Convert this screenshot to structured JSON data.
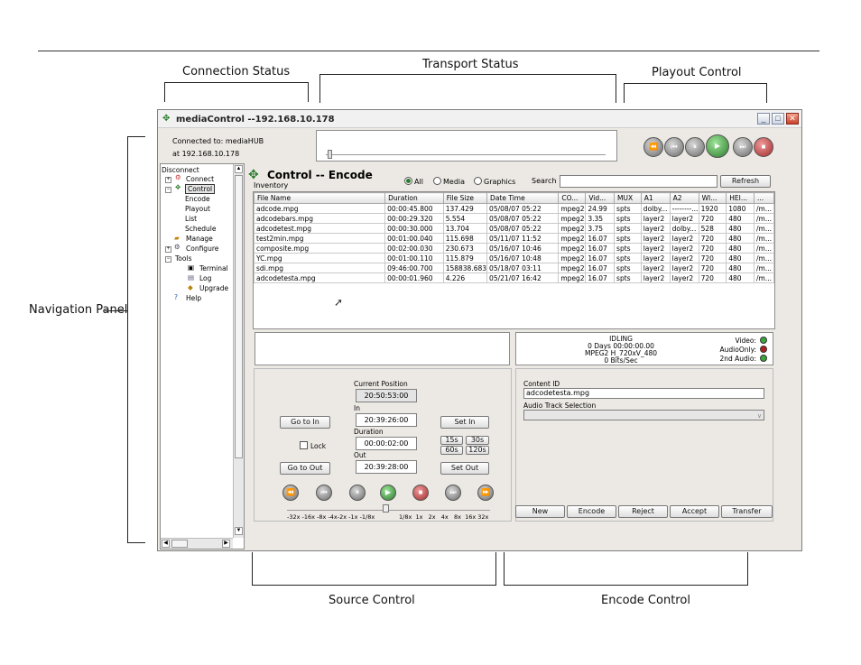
{
  "callouts": {
    "connection_status": "Connection Status",
    "transport_status": "Transport Status",
    "playout_control": "Playout Control",
    "navigation_panel": "Navigation Panel",
    "source_control": "Source Control",
    "encode_control": "Encode Control"
  },
  "window": {
    "title": "mediaControl --192.168.10.178",
    "min": "_",
    "max": "□",
    "close": "✕"
  },
  "connection": {
    "line1": "Connected to: mediaHUB",
    "line2": "at 192.168.10.178"
  },
  "nav": {
    "disconnect": "Disconnect",
    "connect": "Connect",
    "control": "Control",
    "encode": "Encode",
    "playout": "Playout",
    "list": "List",
    "schedule": "Schedule",
    "manage": "Manage",
    "configure": "Configure",
    "tools": "Tools",
    "terminal": "Terminal",
    "log": "Log",
    "upgrade": "Upgrade",
    "help": "Help"
  },
  "inventory": {
    "title": "Control -- Encode",
    "subtitle": "Inventory",
    "radio_all": "All",
    "radio_media": "Media",
    "radio_graphics": "Graphics",
    "search_label": "Search",
    "search_value": "",
    "refresh": "Refresh",
    "columns": [
      "File Name",
      "Duration",
      "File Size",
      "Date Time",
      "CO...",
      "Vid...",
      "MUX",
      "A1",
      "A2",
      "WI...",
      "HEI...",
      "..."
    ],
    "rows": [
      [
        "adcode.mpg",
        "00:00:45.800",
        "137.429",
        "05/08/07 05:22",
        "mpeg2",
        "24.99",
        "spts",
        "dolby...",
        "--------...",
        "1920",
        "1080",
        "/m..."
      ],
      [
        "adcodebars.mpg",
        "00:00:29.320",
        "5.554",
        "05/08/07 05:22",
        "mpeg2",
        "3.35",
        "spts",
        "layer2",
        "layer2",
        "720",
        "480",
        "/m..."
      ],
      [
        "adcodetest.mpg",
        "00:00:30.000",
        "13.704",
        "05/08/07 05:22",
        "mpeg2",
        "3.75",
        "spts",
        "layer2",
        "dolby...",
        "528",
        "480",
        "/m..."
      ],
      [
        "test2min.mpg",
        "00:01:00.040",
        "115.698",
        "05/11/07 11:52",
        "mpeg2",
        "16.07",
        "spts",
        "layer2",
        "layer2",
        "720",
        "480",
        "/m..."
      ],
      [
        "composite.mpg",
        "00:02:00.030",
        "230.673",
        "05/16/07 10:46",
        "mpeg2",
        "16.07",
        "spts",
        "layer2",
        "layer2",
        "720",
        "480",
        "/m..."
      ],
      [
        "YC.mpg",
        "00:01:00.110",
        "115.879",
        "05/16/07 10:48",
        "mpeg2",
        "16.07",
        "spts",
        "layer2",
        "layer2",
        "720",
        "480",
        "/m..."
      ],
      [
        "sdi.mpg",
        "09:46:00.700",
        "158838.683",
        "05/18/07 03:11",
        "mpeg2",
        "16.07",
        "spts",
        "layer2",
        "layer2",
        "720",
        "480",
        "/m..."
      ],
      [
        "adcodetesta.mpg",
        "00:00:01.960",
        "4.226",
        "05/21/07 16:42",
        "mpeg2",
        "16.07",
        "spts",
        "layer2",
        "layer2",
        "720",
        "480",
        "/m..."
      ]
    ]
  },
  "encoder_status": {
    "state": "IDLING",
    "days": "0 Days 00:00:00.00",
    "format": "MPEG2 H_720xV_480",
    "bitrate": "0 Bits/Sec",
    "video_label": "Video:",
    "audio_only_label": "AudioOnly:",
    "second_audio_label": "2nd Audio:",
    "video_color": "#3aa53a",
    "audio_only_color": "#b02020",
    "second_audio_color": "#3aa53a"
  },
  "source": {
    "current_position_label": "Current Position",
    "current_position": "20:50:53:00",
    "in_label": "In",
    "in_value": "20:39:26:00",
    "duration_label": "Duration",
    "duration_value": "00:00:02:00",
    "out_label": "Out",
    "out_value": "20:39:28:00",
    "go_to_in": "Go to In",
    "go_to_out": "Go to Out",
    "set_in": "Set In",
    "set_out": "Set Out",
    "lock": "Lock",
    "btn_15s": "15s",
    "btn_30s": "30s",
    "btn_60s": "60s",
    "btn_120s": "120s",
    "speed_left": "-32x -16x -8x -4x-2x -1x -1/8x",
    "speed_right": "1/8x  1x   2x   4x   8x  16x 32x"
  },
  "encode": {
    "content_id_label": "Content ID",
    "content_id": "adcodetesta.mpg",
    "audio_track_label": "Audio Track Selection",
    "new": "New",
    "encode": "Encode",
    "reject": "Reject",
    "accept": "Accept",
    "transfer": "Transfer"
  },
  "icons": {
    "rewind": "⏪",
    "prev": "⏮",
    "pause": "⏸",
    "play": "▶",
    "stop": "■",
    "next": "⏭",
    "fastforward": "⏩"
  }
}
